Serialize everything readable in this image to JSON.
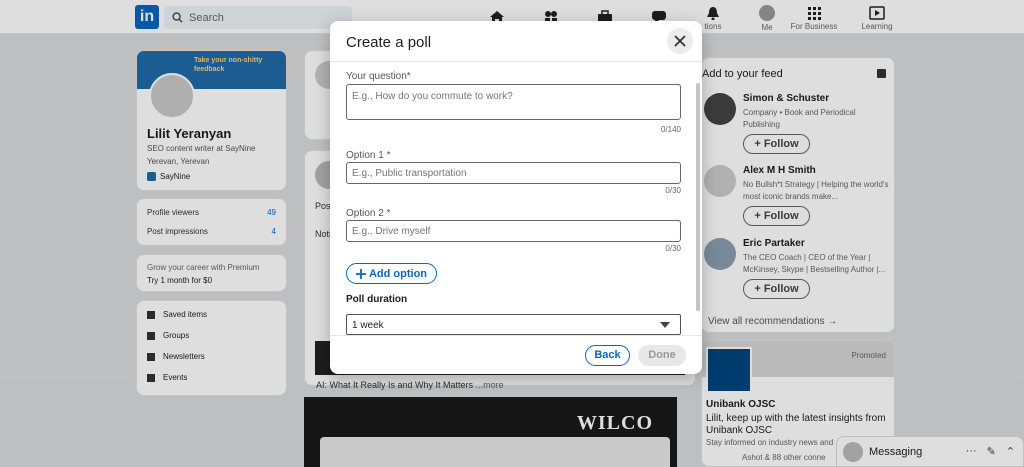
{
  "nav": {
    "search_placeholder": "Search",
    "me_label": "Me",
    "business_label": "For Business",
    "learning_label": "Learning",
    "notif_label": "tions"
  },
  "profile": {
    "banner_text": "Take your non-shitty feedback",
    "name": "Lilit Yeranyan",
    "headline": "SEO content writer at SayNine",
    "location": "Yerevan, Yerevan",
    "company": "SayNine"
  },
  "stats": {
    "viewers_label": "Profile viewers",
    "viewers_value": "49",
    "impressions_label": "Post impressions",
    "impressions_value": "4"
  },
  "premium": {
    "line1": "Grow your career with Premium",
    "line2": "Try 1 month for $0"
  },
  "saved_menu": [
    "Saved items",
    "Groups",
    "Newsletters",
    "Events"
  ],
  "feed": {
    "ai_line": "AI: What It Really Is and Why It Matters",
    "more": "...more",
    "wilco": "WILCO",
    "post_fragment": "Pos",
    "not_fragment": "Noti"
  },
  "right": {
    "title": "Add to your feed",
    "recs": [
      {
        "name": "Simon & Schuster",
        "desc": "Company • Book and Periodical Publishing",
        "follow": "+ Follow"
      },
      {
        "name": "Alex M H Smith",
        "desc": "No Bullsh*t Strategy | Helping the world's most iconic brands make...",
        "follow": "+ Follow"
      },
      {
        "name": "Eric Partaker",
        "desc": "The CEO Coach | CEO of the Year | McKinsey, Skype | Bestselling Author |...",
        "follow": "+ Follow"
      }
    ],
    "view_all": "View all recommendations →"
  },
  "promo": {
    "tag": "Promoted",
    "company": "Unibank OJSC",
    "text": "Lilit, keep up with the latest insights from Unibank OJSC",
    "sub": "Stay informed on industry news and",
    "followers": "Ashot & 88 other conne"
  },
  "messaging": {
    "label": "Messaging"
  },
  "modal": {
    "title": "Create a poll",
    "question_label": "Your question*",
    "question_placeholder": "E.g., How do you commute to work?",
    "question_counter": "0/140",
    "option1_label": "Option 1 *",
    "option1_placeholder": "E.g., Public transportation",
    "option1_counter": "0/30",
    "option2_label": "Option 2 *",
    "option2_placeholder": "E.g., Drive myself",
    "option2_counter": "0/30",
    "add_option": "Add option",
    "duration_label": "Poll duration",
    "duration_value": "1 week",
    "back_label": "Back",
    "done_label": "Done"
  },
  "colors": {
    "accent": "#0a66c2",
    "overlay": "rgba(0,0,0,0.13)"
  }
}
